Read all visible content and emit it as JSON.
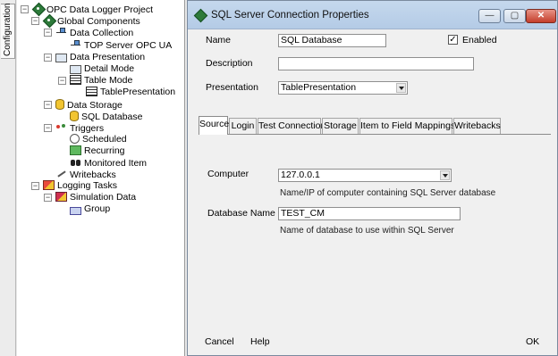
{
  "side_tab": {
    "label": "Configuration"
  },
  "tree": [
    {
      "label": "OPC Data Logger Project",
      "icon": "diamond-icon"
    },
    {
      "label": "Global Components",
      "icon": "diamond-icon"
    },
    {
      "label": "Data Collection",
      "icon": "network-icon"
    },
    {
      "label": "TOP Server OPC UA",
      "icon": "network-icon"
    },
    {
      "label": "Data Presentation",
      "icon": "presentation-icon"
    },
    {
      "label": "Detail Mode",
      "icon": "detail-icon"
    },
    {
      "label": "Table Mode",
      "icon": "table-icon"
    },
    {
      "label": "TablePresentation",
      "icon": "table-icon"
    },
    {
      "label": "Data Storage",
      "icon": "database-icon"
    },
    {
      "label": "SQL Database",
      "icon": "database-icon"
    },
    {
      "label": "Triggers",
      "icon": "trigger-icon"
    },
    {
      "label": "Scheduled",
      "icon": "clock-icon"
    },
    {
      "label": "Recurring",
      "icon": "recurring-icon"
    },
    {
      "label": "Monitored Item",
      "icon": "binoculars-icon"
    },
    {
      "label": "Writebacks",
      "icon": "pen-icon"
    },
    {
      "label": "Logging Tasks",
      "icon": "tasks-icon"
    },
    {
      "label": "Simulation Data",
      "icon": "task-icon"
    },
    {
      "label": "Group",
      "icon": "group-icon"
    }
  ],
  "dialog": {
    "title": "SQL Server Connection Properties",
    "name_label": "Name",
    "name_value": "SQL Database",
    "enabled_label": "Enabled",
    "enabled_checked": "✓",
    "description_label": "Description",
    "description_value": "",
    "presentation_label": "Presentation",
    "presentation_value": "TablePresentation",
    "tabs": [
      "Source",
      "Login",
      "Test Connection",
      "Storage",
      "Item to Field Mappings",
      "Writebacks"
    ],
    "computer_label": "Computer",
    "computer_value": "127.0.0.1",
    "computer_help": "Name/IP of computer containing SQL Server database",
    "db_label": "Database Name",
    "db_value": "TEST_CM",
    "db_help": "Name of database to use within SQL Server",
    "cancel": "Cancel",
    "help": "Help",
    "ok": "OK"
  }
}
